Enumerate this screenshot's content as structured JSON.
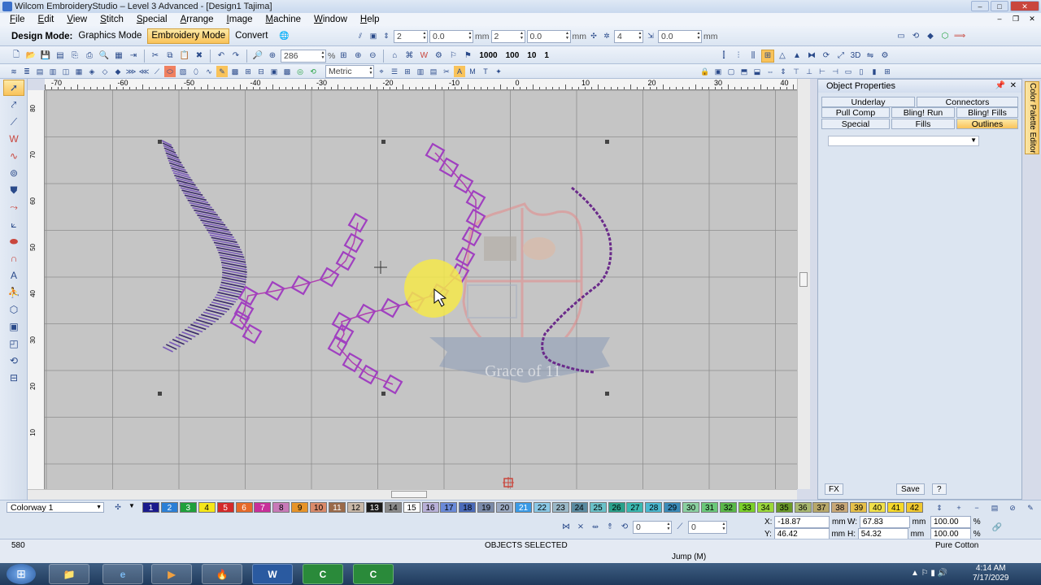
{
  "window": {
    "title": "Wilcom EmbroideryStudio – Level 3 Advanced - [Design1          Tajima]",
    "controls": [
      "–",
      "□",
      "✕"
    ]
  },
  "menu": {
    "items": [
      {
        "key": "F",
        "rest": "ile"
      },
      {
        "key": "E",
        "rest": "dit"
      },
      {
        "key": "V",
        "rest": "iew"
      },
      {
        "key": "S",
        "rest": "titch"
      },
      {
        "key": "S",
        "rest": "pecial"
      },
      {
        "key": "A",
        "rest": "rrange"
      },
      {
        "key": "I",
        "rest": "mage"
      },
      {
        "key": "M",
        "rest": "achine"
      },
      {
        "key": "W",
        "rest": "indow"
      },
      {
        "key": "H",
        "rest": "elp"
      }
    ]
  },
  "toolbar": {
    "design_mode_label": "Design Mode:",
    "graphics_mode": "Graphics Mode",
    "embroidery_mode": "Embroidery Mode",
    "convert": "Convert",
    "field1": "2",
    "field2": "0.0",
    "unit": "mm",
    "field3": "2",
    "field4": "0.0",
    "field5": "4",
    "field6": "0.0",
    "zoom": "286",
    "zoom_unit": "%",
    "stitch_counts": [
      "1000",
      "100",
      "10",
      "1"
    ],
    "units_select": "Metric"
  },
  "ruler": {
    "top_labels": [
      "-70",
      "-60",
      "-50",
      "-40",
      "-30",
      "-20",
      "-10",
      "0",
      "10",
      "20",
      "30",
      "40"
    ],
    "left_labels": [
      "80",
      "70",
      "60",
      "50",
      "40",
      "30",
      "20",
      "10"
    ]
  },
  "panel": {
    "title": "Object Properties",
    "tabs_row1": [
      "Underlay",
      "Connectors"
    ],
    "tabs_row2": [
      "Pull Comp",
      "Bling! Run",
      "Bling! Fills"
    ],
    "tabs_row3": [
      "Special",
      "Fills",
      "Outlines"
    ],
    "fx": "FX",
    "save": "Save",
    "help": "?",
    "side_tab": "Color Palette Editor"
  },
  "colorbar": {
    "colorway": "Colorway 1",
    "swatches": [
      {
        "n": "1",
        "bg": "#1a1a8c",
        "fg": "#fff"
      },
      {
        "n": "2",
        "bg": "#2b7fd6",
        "fg": "#fff"
      },
      {
        "n": "3",
        "bg": "#1fa03c",
        "fg": "#fff"
      },
      {
        "n": "4",
        "bg": "#f5e619",
        "fg": "#000"
      },
      {
        "n": "5",
        "bg": "#d42a2a",
        "fg": "#fff"
      },
      {
        "n": "6",
        "bg": "#e66a2a",
        "fg": "#fff"
      },
      {
        "n": "7",
        "bg": "#c82f9a",
        "fg": "#fff"
      },
      {
        "n": "8",
        "bg": "#c87ab8",
        "fg": "#000"
      },
      {
        "n": "9",
        "bg": "#e6942a",
        "fg": "#000"
      },
      {
        "n": "10",
        "bg": "#d98a6a",
        "fg": "#000"
      },
      {
        "n": "11",
        "bg": "#9a6a4a",
        "fg": "#fff"
      },
      {
        "n": "12",
        "bg": "#c8b8a8",
        "fg": "#000"
      },
      {
        "n": "13",
        "bg": "#1a1a1a",
        "fg": "#fff"
      },
      {
        "n": "14",
        "bg": "#8a8a8a",
        "fg": "#000"
      },
      {
        "n": "15",
        "bg": "#ffffff",
        "fg": "#000"
      },
      {
        "n": "16",
        "bg": "#b8b0d8",
        "fg": "#000"
      },
      {
        "n": "17",
        "bg": "#6a8ad8",
        "fg": "#000"
      },
      {
        "n": "18",
        "bg": "#4a6ab8",
        "fg": "#000"
      },
      {
        "n": "19",
        "bg": "#7a8aa8",
        "fg": "#000"
      },
      {
        "n": "20",
        "bg": "#9aa8c0",
        "fg": "#000"
      },
      {
        "n": "21",
        "bg": "#3a9ae6",
        "fg": "#fff"
      },
      {
        "n": "22",
        "bg": "#8ac8e6",
        "fg": "#000"
      },
      {
        "n": "23",
        "bg": "#9ab8c8",
        "fg": "#000"
      },
      {
        "n": "24",
        "bg": "#5a8aa0",
        "fg": "#000"
      },
      {
        "n": "25",
        "bg": "#6ac0c8",
        "fg": "#000"
      },
      {
        "n": "26",
        "bg": "#2aa08a",
        "fg": "#000"
      },
      {
        "n": "27",
        "bg": "#3ab8b0",
        "fg": "#000"
      },
      {
        "n": "28",
        "bg": "#4ab8d0",
        "fg": "#000"
      },
      {
        "n": "29",
        "bg": "#3a8ab8",
        "fg": "#000"
      },
      {
        "n": "30",
        "bg": "#8ad0a0",
        "fg": "#000"
      },
      {
        "n": "31",
        "bg": "#6ac87a",
        "fg": "#000"
      },
      {
        "n": "32",
        "bg": "#5ab84a",
        "fg": "#000"
      },
      {
        "n": "33",
        "bg": "#7ad02a",
        "fg": "#000"
      },
      {
        "n": "34",
        "bg": "#9ad83a",
        "fg": "#000"
      },
      {
        "n": "35",
        "bg": "#6a9a2a",
        "fg": "#000"
      },
      {
        "n": "36",
        "bg": "#a8b870",
        "fg": "#000"
      },
      {
        "n": "37",
        "bg": "#b8a86a",
        "fg": "#000"
      },
      {
        "n": "38",
        "bg": "#c8a878",
        "fg": "#000"
      },
      {
        "n": "39",
        "bg": "#e6c04a",
        "fg": "#000"
      },
      {
        "n": "40",
        "bg": "#f0e04a",
        "fg": "#000"
      },
      {
        "n": "41",
        "bg": "#f5d82a",
        "fg": "#000"
      },
      {
        "n": "42",
        "bg": "#f0c830",
        "fg": "#000"
      }
    ]
  },
  "transform": {
    "rotate": "0",
    "skew": "0",
    "x_label": "X:",
    "x_value": "-18.87",
    "y_label": "Y:",
    "y_value": "46.42",
    "w_label": "W:",
    "w_value": "67.83",
    "h_label": "H:",
    "h_value": "54.32",
    "unit": "mm",
    "w_pct": "100.00",
    "h_pct": "100.00",
    "pct": "%"
  },
  "status": {
    "stitch_count": "580",
    "selection": "OBJECTS SELECTED",
    "function": "Jump (M)",
    "thread": "Pure Cotton"
  },
  "taskbar": {
    "time": "4:14 AM",
    "date": "7/17/2029"
  },
  "watermark": {
    "text": "Grace of 11"
  }
}
